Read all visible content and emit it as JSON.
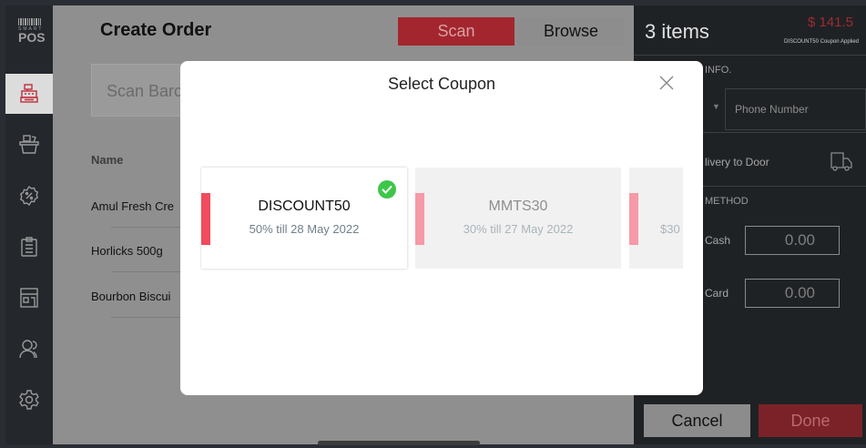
{
  "sidebar": {
    "logo": {
      "smart": "SMART",
      "pos": "POS"
    },
    "items": [
      {
        "icon": "cash-register-icon",
        "active": true
      },
      {
        "icon": "basket-icon"
      },
      {
        "icon": "discount-badge-icon"
      },
      {
        "icon": "clipboard-icon"
      },
      {
        "icon": "store-icon"
      },
      {
        "icon": "users-icon"
      },
      {
        "icon": "settings-gear-icon"
      }
    ]
  },
  "main": {
    "title": "Create Order",
    "tabs": {
      "scan": "Scan",
      "browse": "Browse"
    },
    "search_placeholder": "Scan Barc",
    "column_name": "Name",
    "products": [
      "Amul Fresh Cre",
      "Horlicks 500g",
      "Bourbon Biscui"
    ]
  },
  "right_panel": {
    "items_count": "3 items",
    "amount": "$ 141.5",
    "coupon_applied": "DISCOUNT50 Coupon Applied",
    "customer_info_label": "INFO.",
    "phone_placeholder": "Phone Number",
    "delivery_label": "livery to Door",
    "payment_method_label": "METHOD",
    "payments": [
      {
        "label": "Cash",
        "value": "0.00"
      },
      {
        "label": "Card",
        "value": "0.00"
      }
    ],
    "cancel_label": "Cancel",
    "done_label": "Done"
  },
  "modal": {
    "title": "Select Coupon",
    "coupons": [
      {
        "code": "DISCOUNT50",
        "description": "50% till 28 May 2022",
        "selected": true
      },
      {
        "code": "MMTS30",
        "description": "30% till 27 May 2022",
        "selected": false
      },
      {
        "code": "",
        "description": "$30",
        "selected": false
      }
    ]
  },
  "colors": {
    "accent_red": "#a3262f",
    "coupon_stripe": "#f04b5e",
    "check_green": "#3ec64b"
  }
}
